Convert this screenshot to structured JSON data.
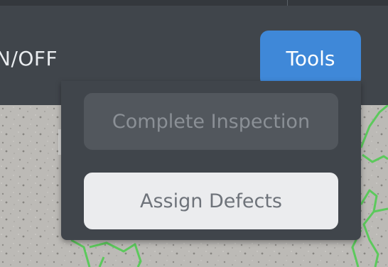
{
  "header": {
    "label": "N/OFF",
    "tools_button_label": "Tools"
  },
  "tools_menu": {
    "items": [
      {
        "label": "Complete Inspection",
        "state": "disabled"
      },
      {
        "label": "Assign Defects",
        "state": "enabled"
      }
    ]
  },
  "colors": {
    "header_background": "#40454b",
    "accent": "#3f88d8",
    "menu_background": "#40454b",
    "disabled_item_background": "#52575d",
    "enabled_item_background": "#ebecee",
    "defect_outline": "#5cc95c"
  }
}
